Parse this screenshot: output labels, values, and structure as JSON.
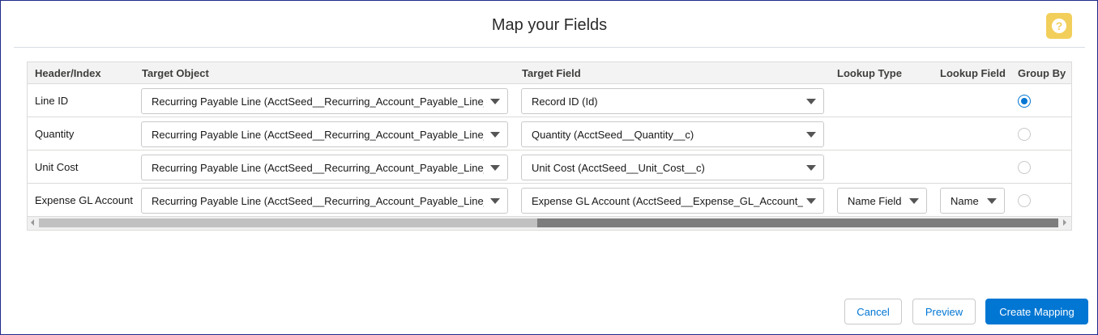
{
  "modal": {
    "title": "Map your Fields",
    "help_icon": "question-mark-icon"
  },
  "table": {
    "headers": {
      "header_index": "Header/Index",
      "target_object": "Target Object",
      "target_field": "Target Field",
      "lookup_type": "Lookup Type",
      "lookup_field": "Lookup Field",
      "group_by": "Group By"
    },
    "rows": [
      {
        "label": "Line ID",
        "target_object": "Recurring Payable Line (AcctSeed__Recurring_Account_Payable_Line__c)",
        "target_field": "Record ID (Id)",
        "lookup_type": "",
        "lookup_field": "",
        "group_by": true
      },
      {
        "label": "Quantity",
        "target_object": "Recurring Payable Line (AcctSeed__Recurring_Account_Payable_Line__c)",
        "target_field": "Quantity (AcctSeed__Quantity__c)",
        "lookup_type": "",
        "lookup_field": "",
        "group_by": false
      },
      {
        "label": "Unit Cost",
        "target_object": "Recurring Payable Line (AcctSeed__Recurring_Account_Payable_Line__c)",
        "target_field": "Unit Cost (AcctSeed__Unit_Cost__c)",
        "lookup_type": "",
        "lookup_field": "",
        "group_by": false
      },
      {
        "label": "Expense GL Account",
        "target_object": "Recurring Payable Line (AcctSeed__Recurring_Account_Payable_Line__c)",
        "target_field": "Expense GL Account (AcctSeed__Expense_GL_Account__c)",
        "lookup_type": "Name Field",
        "lookup_field": "Name",
        "group_by": false
      }
    ],
    "scroll_position": 0.49
  },
  "footer": {
    "cancel_label": "Cancel",
    "preview_label": "Preview",
    "create_label": "Create Mapping"
  },
  "colors": {
    "brand": "#0176d3",
    "help_badge": "#f2cf5b"
  }
}
